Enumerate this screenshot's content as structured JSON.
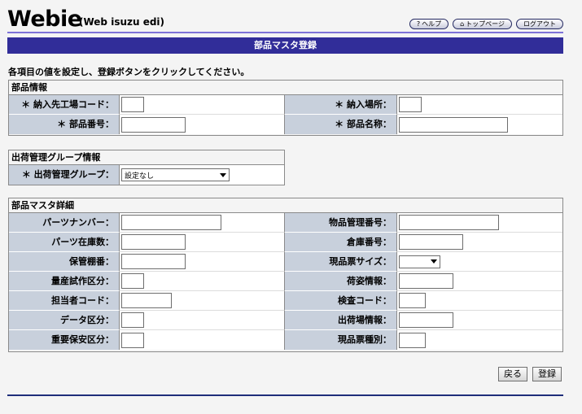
{
  "header": {
    "logo": "Webie",
    "logo_sub": "(Web isuzu edi)",
    "nav": {
      "help": "ヘルプ",
      "help_icon": "?",
      "top": "トップページ",
      "top_icon": "⌂",
      "logout": "ログアウト"
    }
  },
  "page_title": "部品マスタ登録",
  "instruction": "各項目の値を設定し、登録ボタンをクリックしてください。",
  "section_parts": {
    "title": "部品情報",
    "supplier_code_label": "＊ 納入先工場コード：",
    "supplier_code_value": "",
    "delivery_place_label": "＊ 納入場所：",
    "delivery_place_value": "",
    "part_number_label": "＊ 部品番号：",
    "part_number_value": "",
    "part_name_label": "＊ 部品名称：",
    "part_name_value": ""
  },
  "section_shipping": {
    "title": "出荷管理グループ情報",
    "group_label": "＊ 出荷管理グループ：",
    "group_value": "設定なし"
  },
  "section_detail": {
    "title": "部品マスタ詳細",
    "part_nanbaa_label": "パーツナンバー：",
    "part_nanbaa_value": "",
    "stock_mgmt_no_label": "物品管理番号：",
    "stock_mgmt_no_value": "",
    "parts_stock_qty_label": "パーツ在庫数：",
    "parts_stock_qty_value": "",
    "warehouse_no_label": "倉庫番号：",
    "warehouse_no_value": "",
    "storage_shelf_label": "保管棚番：",
    "storage_shelf_value": "",
    "label_size_label": "現品票サイズ：",
    "label_size_value": "",
    "mass_trial_label": "量産試作区分：",
    "mass_trial_value": "",
    "packing_info_label": "荷姿情報：",
    "packing_info_value": "",
    "person_code_label": "担当者コード：",
    "person_code_value": "",
    "inspection_code_label": "検査コード：",
    "inspection_code_value": "",
    "data_class_label": "データ区分：",
    "data_class_value": "",
    "shipping_place_label": "出荷場情報：",
    "shipping_place_value": "",
    "safety_class_label": "重要保安区分：",
    "safety_class_value": "",
    "label_type_label": "現品票種別：",
    "label_type_value": ""
  },
  "footer": {
    "back_label": "戻る",
    "register_label": "登録"
  },
  "colors": {
    "title_bar": "#312d99",
    "label_bg": "#c8d0dc",
    "top_rule": "#7d72d8"
  }
}
